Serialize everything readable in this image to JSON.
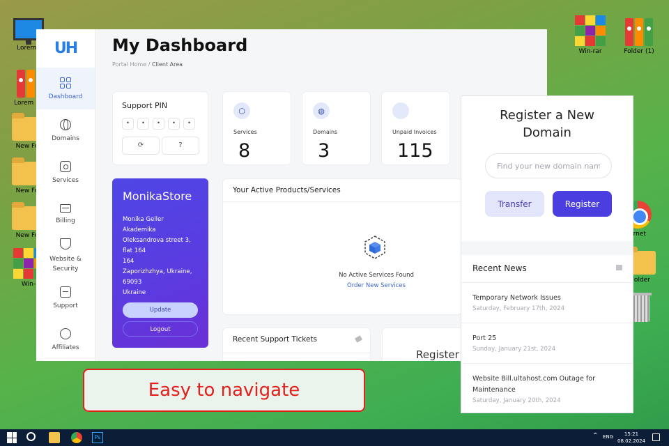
{
  "desktop": {
    "icons": [
      "Lorem I",
      "Lorem I",
      "New Fo",
      "New Fo",
      "New Fo",
      "Win-",
      "Win-rar",
      "Folder (1)",
      "ernet",
      "Folder"
    ]
  },
  "app": {
    "logo": "UH",
    "page_title": "My Dashboard",
    "breadcrumb": {
      "home": "Portal Home",
      "separator": "/",
      "current": "Client Area"
    },
    "sidebar": [
      {
        "label": "Dashboard",
        "icon": "grid-icon",
        "active": true
      },
      {
        "label": "Domains",
        "icon": "globe-icon"
      },
      {
        "label": "Services",
        "icon": "box-icon"
      },
      {
        "label": "Billing",
        "icon": "card-icon"
      },
      {
        "label": "Website & Security",
        "icon": "shield-icon"
      },
      {
        "label": "Support",
        "icon": "support-icon"
      },
      {
        "label": "Affiliates",
        "icon": "coin-icon"
      }
    ],
    "support_pin": {
      "label": "Support PIN",
      "digits": [
        "•",
        "•",
        "•",
        "•",
        "•"
      ],
      "refresh": "⟳",
      "help": "?"
    },
    "stats": [
      {
        "label": "Services",
        "value": "8",
        "icon": "⬡"
      },
      {
        "label": "Domains",
        "value": "3",
        "icon": "◍"
      },
      {
        "label": "Unpaid Invoices",
        "value": "115",
        "icon": ""
      }
    ],
    "store": {
      "name": "MonikaStore",
      "address_lines": [
        "Monika Geller",
        "Akademika",
        "Oleksandrova street 3,",
        "flat 164",
        "164",
        "Zaporizhzhya, Ukraine,",
        "69093",
        "Ukraine"
      ],
      "update": "Update",
      "logout": "Logout"
    },
    "products": {
      "title": "Your Active Products/Services",
      "empty_text": "No Active Services Found",
      "order_link": "Order New Services"
    },
    "tickets": {
      "title": "Recent Support Tickets"
    },
    "register_peek": "Register"
  },
  "register_panel": {
    "title": "Register a New Domain",
    "placeholder": "Find your new domain name",
    "transfer": "Transfer",
    "register": "Register"
  },
  "news": {
    "title": "Recent News",
    "items": [
      {
        "title": "Temporary Network Issues",
        "date": "Saturday, February 17th, 2024"
      },
      {
        "title": "Port 25",
        "date": "Sunday, January 21st, 2024"
      },
      {
        "title": "Website Bill.ultahost.com Outage for Maintenance",
        "date": "Saturday, January 20th, 2024"
      }
    ]
  },
  "callout": "Easy to navigate",
  "taskbar": {
    "lang": "ENG",
    "time": "15:21",
    "date": "08.02.2024",
    "ps": "Ps",
    "tray_arrow": "⌃"
  },
  "colors": {
    "accent": "#4a3ee0",
    "callout_red": "#e0211d",
    "taskbar": "#0c1d38"
  }
}
